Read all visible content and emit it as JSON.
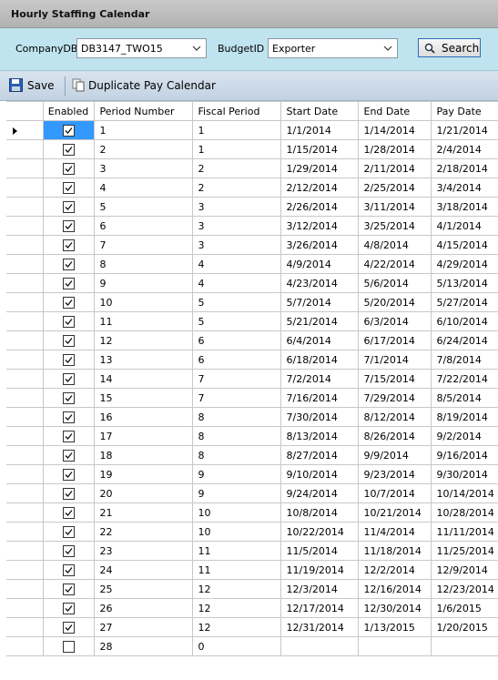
{
  "window": {
    "title": "Hourly Staffing Calendar"
  },
  "filters": {
    "company_label": "CompanyDB",
    "company_value": "DB3147_TWO15",
    "budget_label": "BudgetID",
    "budget_value": "Exporter",
    "search_label": "Search"
  },
  "toolbar": {
    "save_label": "Save",
    "duplicate_label": "Duplicate Pay Calendar"
  },
  "colors": {
    "header": "#bfe3ef",
    "selection": "#3399ff",
    "toolbar": "#c3d2e2"
  },
  "table": {
    "columns": [
      "Enabled",
      "Period Number",
      "Fiscal Period",
      "Start Date",
      "End Date",
      "Pay Date"
    ],
    "rows": [
      {
        "enabled": true,
        "period": "1",
        "fiscal": "1",
        "start": "1/1/2014",
        "end": "1/14/2014",
        "pay": "1/21/2014"
      },
      {
        "enabled": true,
        "period": "2",
        "fiscal": "1",
        "start": "1/15/2014",
        "end": "1/28/2014",
        "pay": "2/4/2014"
      },
      {
        "enabled": true,
        "period": "3",
        "fiscal": "2",
        "start": "1/29/2014",
        "end": "2/11/2014",
        "pay": "2/18/2014"
      },
      {
        "enabled": true,
        "period": "4",
        "fiscal": "2",
        "start": "2/12/2014",
        "end": "2/25/2014",
        "pay": "3/4/2014"
      },
      {
        "enabled": true,
        "period": "5",
        "fiscal": "3",
        "start": "2/26/2014",
        "end": "3/11/2014",
        "pay": "3/18/2014"
      },
      {
        "enabled": true,
        "period": "6",
        "fiscal": "3",
        "start": "3/12/2014",
        "end": "3/25/2014",
        "pay": "4/1/2014"
      },
      {
        "enabled": true,
        "period": "7",
        "fiscal": "3",
        "start": "3/26/2014",
        "end": "4/8/2014",
        "pay": "4/15/2014"
      },
      {
        "enabled": true,
        "period": "8",
        "fiscal": "4",
        "start": "4/9/2014",
        "end": "4/22/2014",
        "pay": "4/29/2014"
      },
      {
        "enabled": true,
        "period": "9",
        "fiscal": "4",
        "start": "4/23/2014",
        "end": "5/6/2014",
        "pay": "5/13/2014"
      },
      {
        "enabled": true,
        "period": "10",
        "fiscal": "5",
        "start": "5/7/2014",
        "end": "5/20/2014",
        "pay": "5/27/2014"
      },
      {
        "enabled": true,
        "period": "11",
        "fiscal": "5",
        "start": "5/21/2014",
        "end": "6/3/2014",
        "pay": "6/10/2014"
      },
      {
        "enabled": true,
        "period": "12",
        "fiscal": "6",
        "start": "6/4/2014",
        "end": "6/17/2014",
        "pay": "6/24/2014"
      },
      {
        "enabled": true,
        "period": "13",
        "fiscal": "6",
        "start": "6/18/2014",
        "end": "7/1/2014",
        "pay": "7/8/2014"
      },
      {
        "enabled": true,
        "period": "14",
        "fiscal": "7",
        "start": "7/2/2014",
        "end": "7/15/2014",
        "pay": "7/22/2014"
      },
      {
        "enabled": true,
        "period": "15",
        "fiscal": "7",
        "start": "7/16/2014",
        "end": "7/29/2014",
        "pay": "8/5/2014"
      },
      {
        "enabled": true,
        "period": "16",
        "fiscal": "8",
        "start": "7/30/2014",
        "end": "8/12/2014",
        "pay": "8/19/2014"
      },
      {
        "enabled": true,
        "period": "17",
        "fiscal": "8",
        "start": "8/13/2014",
        "end": "8/26/2014",
        "pay": "9/2/2014"
      },
      {
        "enabled": true,
        "period": "18",
        "fiscal": "8",
        "start": "8/27/2014",
        "end": "9/9/2014",
        "pay": "9/16/2014"
      },
      {
        "enabled": true,
        "period": "19",
        "fiscal": "9",
        "start": "9/10/2014",
        "end": "9/23/2014",
        "pay": "9/30/2014"
      },
      {
        "enabled": true,
        "period": "20",
        "fiscal": "9",
        "start": "9/24/2014",
        "end": "10/7/2014",
        "pay": "10/14/2014"
      },
      {
        "enabled": true,
        "period": "21",
        "fiscal": "10",
        "start": "10/8/2014",
        "end": "10/21/2014",
        "pay": "10/28/2014"
      },
      {
        "enabled": true,
        "period": "22",
        "fiscal": "10",
        "start": "10/22/2014",
        "end": "11/4/2014",
        "pay": "11/11/2014"
      },
      {
        "enabled": true,
        "period": "23",
        "fiscal": "11",
        "start": "11/5/2014",
        "end": "11/18/2014",
        "pay": "11/25/2014"
      },
      {
        "enabled": true,
        "period": "24",
        "fiscal": "11",
        "start": "11/19/2014",
        "end": "12/2/2014",
        "pay": "12/9/2014"
      },
      {
        "enabled": true,
        "period": "25",
        "fiscal": "12",
        "start": "12/3/2014",
        "end": "12/16/2014",
        "pay": "12/23/2014"
      },
      {
        "enabled": true,
        "period": "26",
        "fiscal": "12",
        "start": "12/17/2014",
        "end": "12/30/2014",
        "pay": "1/6/2015"
      },
      {
        "enabled": true,
        "period": "27",
        "fiscal": "12",
        "start": "12/31/2014",
        "end": "1/13/2015",
        "pay": "1/20/2015"
      },
      {
        "enabled": false,
        "period": "28",
        "fiscal": "0",
        "start": "",
        "end": "",
        "pay": ""
      }
    ]
  }
}
